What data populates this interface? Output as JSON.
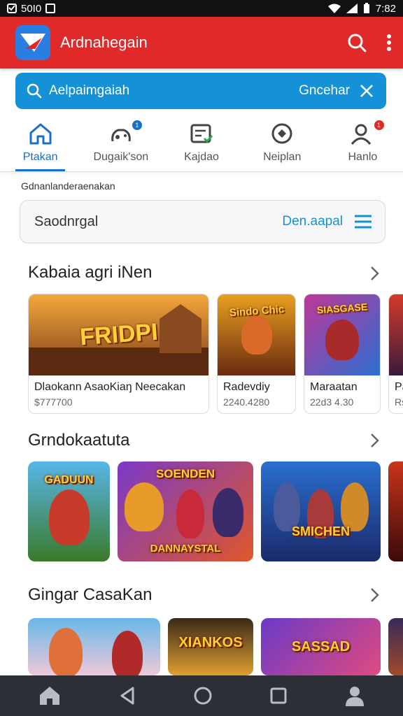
{
  "status_bar": {
    "left_text": "50I0",
    "time": "7:82"
  },
  "app_bar": {
    "title": "Ardnahegain",
    "icons": [
      "search-icon",
      "more-vert-icon"
    ]
  },
  "search": {
    "placeholder": "Aelpaimgaiah",
    "action": "Gncehar",
    "icons": [
      "search-icon",
      "close-icon"
    ]
  },
  "tabs": [
    {
      "label": "Ptakan",
      "icon": "home-icon",
      "active": true
    },
    {
      "label": "Dugaik'son",
      "icon": "gamepad-icon",
      "badge": "1"
    },
    {
      "label": "Kajdao",
      "icon": "checklist-icon"
    },
    {
      "label": "Neiplan",
      "icon": "chat-icon"
    },
    {
      "label": "Hanlo",
      "icon": "profile-icon",
      "badge": "1"
    }
  ],
  "section_hint": "Gdnanlanderaenakan",
  "category": {
    "label": "Saodnrgal",
    "action": "Den.aapal",
    "icon": "menu-icon"
  },
  "sections": [
    {
      "title": "Kabaia agri iNen",
      "cards": [
        {
          "title": "Dlaokann AsaoKiaŋ Neecakan",
          "subtitle": "$777700",
          "art_text": "FRIDPI",
          "colors": [
            "#f6a83a",
            "#7a3d1a"
          ]
        },
        {
          "title": "Radevdiy",
          "subtitle": "2240.4280",
          "art_text": "Sindo Chic",
          "colors": [
            "#e8a020",
            "#6a2a10"
          ]
        },
        {
          "title": "Maraatan",
          "subtitle": "22d3 4.30",
          "art_text": "SIASGASE",
          "colors": [
            "#c0369a",
            "#2a6fd0"
          ]
        },
        {
          "title": "Pa",
          "subtitle": "Rs",
          "art_text": "",
          "colors": [
            "#d23a2a",
            "#3a1a3a"
          ]
        }
      ]
    },
    {
      "title": "Grndokaatuta",
      "tiles": [
        {
          "art_text": "GADUUN",
          "colors": [
            "#58b6e8",
            "#3a7a2a"
          ]
        },
        {
          "art_text": "SOENDEN",
          "art_text_2": "DANNAYSTAL",
          "colors": [
            "#7a3ac8",
            "#e0572a"
          ]
        },
        {
          "art_text": "SMICHEN",
          "colors": [
            "#2a6fd0",
            "#1a2a6a"
          ]
        },
        {
          "art_text": "",
          "colors": [
            "#c8341a",
            "#3a0a0a"
          ]
        }
      ]
    },
    {
      "title": "Gingar CasaKan",
      "tiles": [
        {
          "art_text": "",
          "colors": [
            "#f0c8d8",
            "#68b8e8"
          ]
        },
        {
          "art_text": "XIANKOS",
          "colors": [
            "#3a2a1a",
            "#e0a030"
          ]
        },
        {
          "art_text": "SASSAD",
          "colors": [
            "#6a3ac8",
            "#e04a80"
          ]
        },
        {
          "art_text": "",
          "colors": [
            "#3a2a5a",
            "#a04a2a"
          ]
        }
      ]
    }
  ],
  "nav_bar": {
    "icons": [
      "home-icon",
      "back-icon",
      "home-circle-icon",
      "recents-icon",
      "profile-icon"
    ]
  }
}
